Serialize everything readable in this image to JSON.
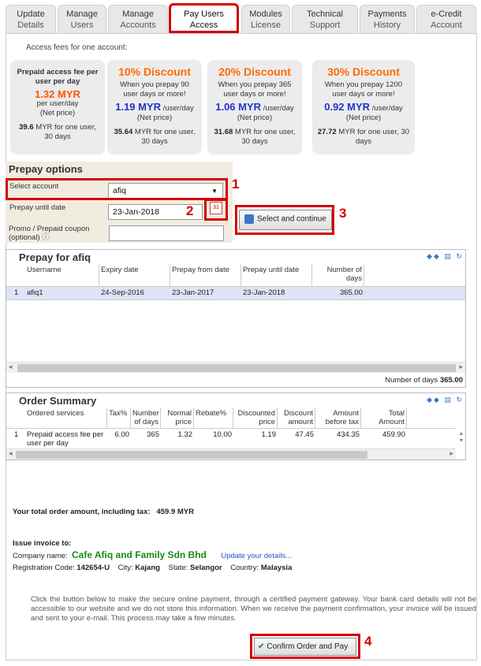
{
  "tabs": [
    {
      "line1": "Update",
      "line2": "Details"
    },
    {
      "line1": "Manage",
      "line2": "Users"
    },
    {
      "line1": "Manage",
      "line2": "Accounts"
    },
    {
      "line1": "Pay Users",
      "line2": "Access"
    },
    {
      "line1": "Modules",
      "line2": "License"
    },
    {
      "line1": "Technical",
      "line2": "Support"
    },
    {
      "line1": "Payments",
      "line2": "History"
    },
    {
      "line1": "e-Credit",
      "line2": "Account"
    }
  ],
  "fees_title": "Access fees for one account:",
  "cards": [
    {
      "head": "Prepaid access fee per user per day",
      "price": "1.32 MYR",
      "unit": "per user/day",
      "note": "(Net price)",
      "bottom_bold": "39.6",
      "bottom": "MYR for one user, 30 days"
    },
    {
      "head": "10% Discount",
      "desc": "When you prepay 90 user days or more!",
      "price": "1.19 MYR",
      "unit": "/user/day",
      "note": "(Net price)",
      "bottom_bold": "35.64",
      "bottom": "MYR for one user, 30 days"
    },
    {
      "head": "20% Discount",
      "desc": "When you prepay 365 user days or more!",
      "price": "1.06 MYR",
      "unit": "/user/day",
      "note": "(Net price)",
      "bottom_bold": "31.68",
      "bottom": "MYR for one user, 30 days"
    },
    {
      "head": "30% Discount",
      "desc": "When you prepay 1200 user days or more!",
      "price": "0.92 MYR",
      "unit": "/user/day",
      "note": "(Net price)",
      "bottom_bold": "27.72",
      "bottom": "MYR for one user, 30 days"
    }
  ],
  "prepay": {
    "title": "Prepay options",
    "select_account_label": "Select account",
    "select_account_value": "afiq",
    "until_label": "Prepay until date",
    "until_value": "23-Jan-2018",
    "coupon_label": "Promo / Prepaid coupon (optional)",
    "coupon_value": "",
    "select_continue": "Select and continue"
  },
  "markers": [
    "1",
    "2",
    "3",
    "4"
  ],
  "prepay_table": {
    "title": "Prepay for afiq",
    "columns": [
      "Username",
      "Expiry date",
      "Prepay from date",
      "Prepay until date",
      "Number of days"
    ],
    "rows": [
      {
        "index": "1",
        "cells": [
          "afiq1",
          "24-Sep-2016",
          "23-Jan-2017",
          "23-Jan-2018",
          "365.00"
        ]
      }
    ],
    "footer_label": "Number of days",
    "footer_value": "365.00"
  },
  "order": {
    "title": "Order Summary",
    "columns": [
      "Ordered services",
      "Tax%",
      "Number of days",
      "Normal price",
      "Rebate%",
      "Discounted price",
      "Discount amount",
      "Amount before tax",
      "Total Amount"
    ],
    "rows": [
      {
        "index": "1",
        "cells": [
          "Prepaid access fee per user per day",
          "6.00",
          "365",
          "1.32",
          "10.00",
          "1.19",
          "47.45",
          "434.35",
          "459.90"
        ]
      }
    ]
  },
  "total_label": "Your total order amount, including tax:",
  "total_value": "459.9 MYR",
  "invoice": {
    "title": "Issue invoice to:",
    "company_label": "Company name:",
    "company": "Cafe Afiq and Family Sdn Bhd",
    "update_link": "Update your details...",
    "reg_label": "Registration Code:",
    "reg": "142654-U",
    "city_label": "City:",
    "city": "Kajang",
    "state_label": "State:",
    "state": "Selangor",
    "country_label": "Country:",
    "country": "Malaysia"
  },
  "notice": "Click the button below to make the secure online payment, through a certified payment gateway. Your bank card details will not be accessible to our website and we do not store this information. When we receive the payment confirmation, your invoice will be issued and sent to your e-mail. This process may take a few minutes.",
  "confirm_label": "Confirm Order and Pay",
  "colors": {
    "accent": "#d40000",
    "discount": "#ff6a00",
    "price": "#2233cc"
  }
}
